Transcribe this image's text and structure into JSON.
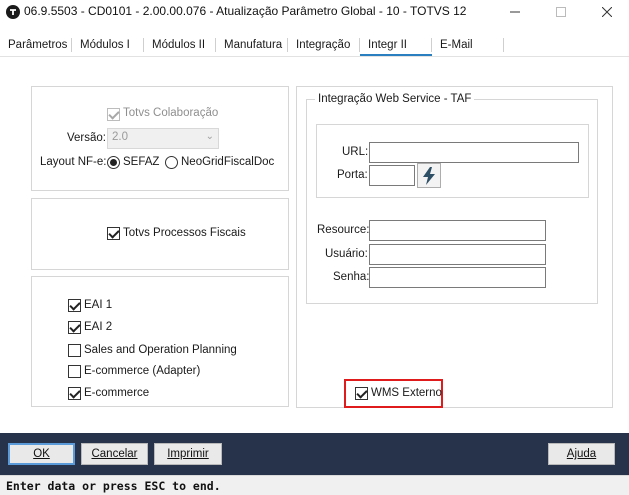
{
  "window": {
    "title": "06.9.5503 - CD0101 - 2.00.00.076 - Atualização Parâmetro Global - 10 - TOTVS 12",
    "icons": {
      "app": "totvs-logo-icon",
      "minimize": "minimize-icon",
      "maximize": "maximize-icon",
      "close": "close-icon"
    }
  },
  "tabs": [
    {
      "label": "Parâmetros"
    },
    {
      "label": "Módulos I"
    },
    {
      "label": "Módulos II"
    },
    {
      "label": "Manufatura"
    },
    {
      "label": "Integração"
    },
    {
      "label": "Integr II",
      "active": true
    },
    {
      "label": "E-Mail"
    }
  ],
  "colaboracao": {
    "checkbox_label": "Totvs Colaboração",
    "checked": true,
    "version_label": "Versão:",
    "version_value": "2.0",
    "layout_label": "Layout NF-e:",
    "layout_options": [
      "SEFAZ",
      "NeoGridFiscalDoc"
    ],
    "layout_selected": "SEFAZ"
  },
  "processos_fiscais": {
    "label": "Totvs Processos Fiscais",
    "checked": true
  },
  "integracoes": [
    {
      "label": "EAI 1",
      "checked": true
    },
    {
      "label": "EAI 2",
      "checked": true
    },
    {
      "label": "Sales and Operation Planning",
      "checked": false
    },
    {
      "label": "E-commerce (Adapter)",
      "checked": false
    },
    {
      "label": "E-commerce",
      "checked": true
    }
  ],
  "taf": {
    "legend": "Integração Web Service - TAF",
    "url_label": "URL:",
    "url_value": "",
    "porta_label": "Porta:",
    "porta_value": "",
    "test_icon": "lightning-icon",
    "resource_label": "Resource:",
    "resource_value": "",
    "usuario_label": "Usuário:",
    "usuario_value": "",
    "senha_label": "Senha:",
    "senha_value": ""
  },
  "wms": {
    "label": "WMS Externo",
    "checked": true,
    "highlight_color": "#e01b1b"
  },
  "buttons": {
    "ok": "OK",
    "cancelar": "Cancelar",
    "imprimir": "Imprimir",
    "ajuda": "Ajuda"
  },
  "status_text": "Enter data or press ESC to end.",
  "colors": {
    "accent": "#2a7fc0",
    "bottom_bar": "#26334a"
  }
}
